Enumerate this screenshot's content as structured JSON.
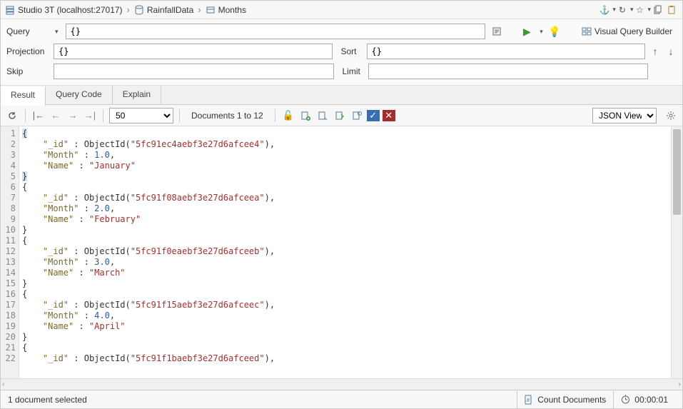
{
  "breadcrumb": {
    "connection": "Studio 3T (localhost:27017)",
    "database": "RainfallData",
    "collection": "Months"
  },
  "query": {
    "query_label": "Query",
    "query_value": "{}",
    "projection_label": "Projection",
    "projection_value": "{}",
    "sort_label": "Sort",
    "sort_value": "{}",
    "skip_label": "Skip",
    "skip_value": "",
    "limit_label": "Limit",
    "limit_value": "",
    "vqb_label": "Visual Query Builder"
  },
  "tabs": {
    "result": "Result",
    "query_code": "Query Code",
    "explain": "Explain"
  },
  "toolbar": {
    "page_size": "50",
    "docs_label": "Documents 1 to 12",
    "view_mode": "JSON View"
  },
  "documents": [
    {
      "_id": "5fc91ec4aebf3e27d6afcee4",
      "Month": 1.0,
      "Name": "January"
    },
    {
      "_id": "5fc91f08aebf3e27d6afceea",
      "Month": 2.0,
      "Name": "February"
    },
    {
      "_id": "5fc91f0eaebf3e27d6afceeb",
      "Month": 3.0,
      "Name": "March"
    },
    {
      "_id": "5fc91f15aebf3e27d6afceec",
      "Month": 4.0,
      "Name": "April"
    },
    {
      "_id_partial": "5fc91f1baebf3e27d6afceed"
    }
  ],
  "status": {
    "selection": "1 document selected",
    "count_label": "Count Documents",
    "elapsed": "00:00:01"
  }
}
